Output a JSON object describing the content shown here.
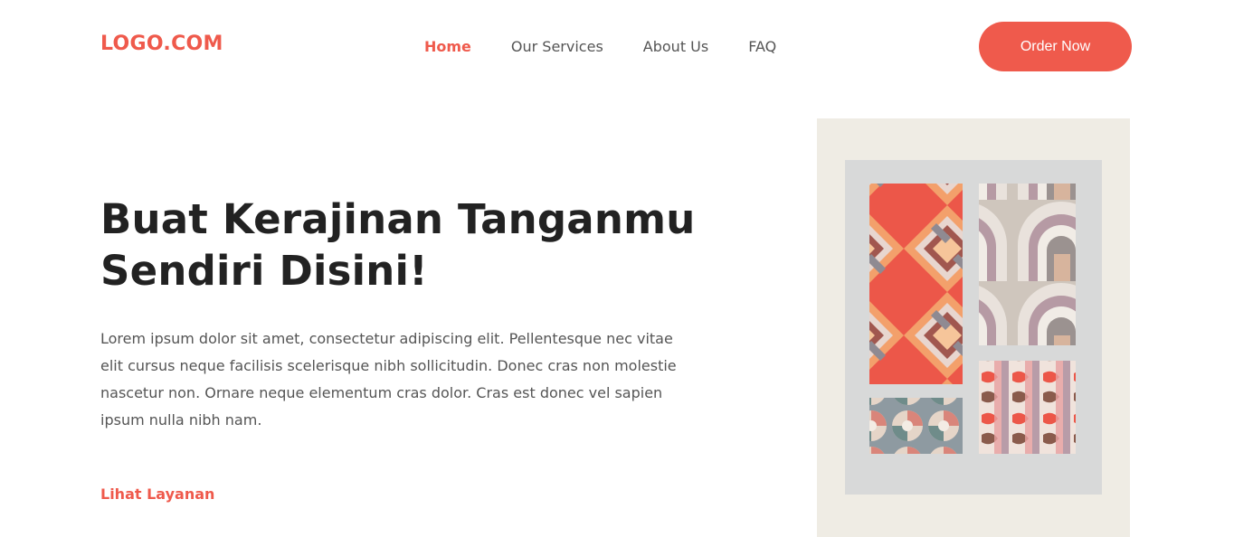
{
  "brand": {
    "logo_text": "LOGO.COM"
  },
  "nav": {
    "items": [
      {
        "label": "Home",
        "active": true
      },
      {
        "label": "Our Services",
        "active": false
      },
      {
        "label": "About Us",
        "active": false
      },
      {
        "label": "FAQ",
        "active": false
      }
    ]
  },
  "header": {
    "cta_label": "Order Now"
  },
  "hero": {
    "title_line1": "Buat Kerajinan Tanganmu",
    "title_line2": "Sendiri Disini!",
    "description": "Lorem ipsum dolor sit amet, consectetur adipiscing elit. Pellentesque nec vitae elit cursus neque facilisis scelerisque nibh sollicitudin. Donec cras non molestie nascetur non. Ornare neque elementum cras dolor. Cras est donec vel sapien ipsum nulla nibh nam.",
    "link_label": "Lihat Layanan"
  },
  "colors": {
    "accent": "#ef5a4c",
    "text_dark": "#222222",
    "text_muted": "#555555"
  }
}
